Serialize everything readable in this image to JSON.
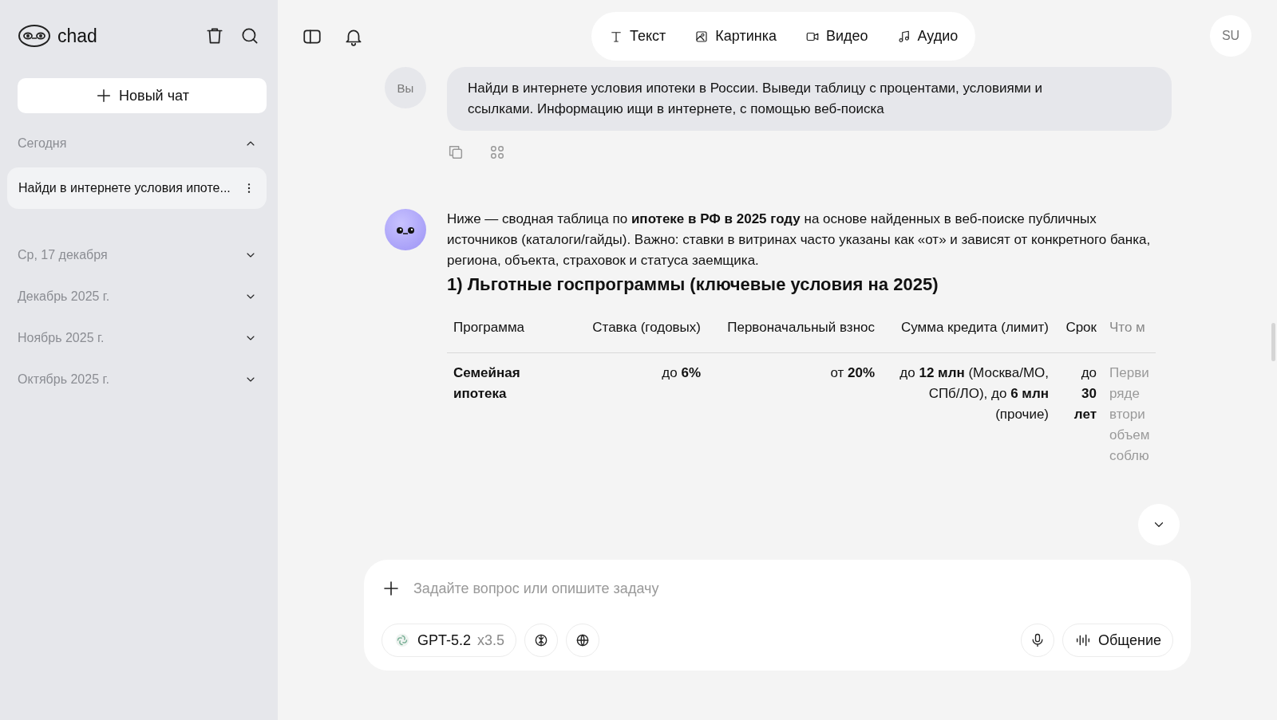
{
  "sidebar": {
    "brand": "chad",
    "new_chat": "Новый чат",
    "sections": [
      {
        "title": "Сегодня",
        "expanded": true,
        "items": [
          {
            "title": "Найди в интернете условия ипоте...",
            "selected": true
          }
        ]
      },
      {
        "title": "Ср, 17 декабря",
        "expanded": false
      },
      {
        "title": "Декабрь 2025 г.",
        "expanded": false
      },
      {
        "title": "Ноябрь 2025 г.",
        "expanded": false
      },
      {
        "title": "Октябрь 2025 г.",
        "expanded": false
      }
    ]
  },
  "modes": [
    {
      "kind": "text",
      "label": "Текст"
    },
    {
      "kind": "image",
      "label": "Картинка"
    },
    {
      "kind": "video",
      "label": "Видео"
    },
    {
      "kind": "audio",
      "label": "Аудио"
    }
  ],
  "user_avatar": "SU",
  "messages": [
    {
      "kind": "user",
      "avatar": "Вы",
      "text": "Найди в интернете условия ипотеки в России. Выведи таблицу с процентами, условиями и ссылками. Информацию ищи в интернете, с помощью веб-поиска"
    },
    {
      "kind": "assistant",
      "text": "Ниже — сводная таблица по **ипотеке в РФ в 2025 году** на основе найденных в веб-поиске публичных источников (каталоги/гайды). Важно: ставки в витринах часто указаны как «от» и зависят от конкретного банка, региона, объекта, страховок и статуса заемщика.",
      "heading": "1) Льготные госпрограммы (ключевые условия на 2025)",
      "table": {
        "columns": [
          "Программа",
          "Ставка (годовых)",
          "Первоначальный взнос",
          "Сумма кредита (лимит)",
          "Срок",
          "Что м"
        ],
        "rows": [
          [
            [
              "**Семейная ипотека**"
            ],
            [
              "до **6%**"
            ],
            [
              "от **20%**"
            ],
            [
              "до **12 млн** (Москва/МО,",
              "СПб/ЛО), до **6 млн**",
              "(прочие)"
            ],
            [
              "до",
              "**30**",
              "**лет**"
            ],
            [
              "Перви",
              "ряде",
              "втори",
              "объем",
              "соблю"
            ]
          ]
        ]
      }
    }
  ],
  "composer": {
    "placeholder": "Задайте вопрос или опишите задачу",
    "model": "GPT-5.2",
    "multiplier": "x3.5",
    "voice": "Общение"
  }
}
